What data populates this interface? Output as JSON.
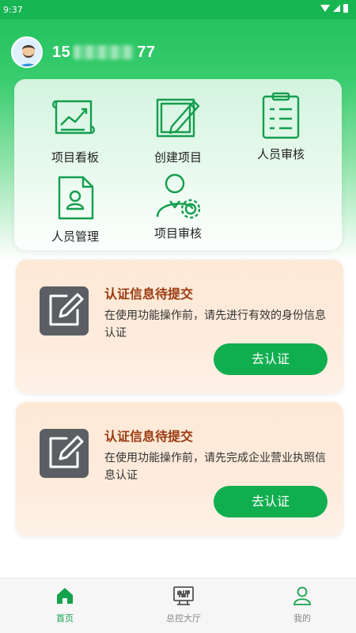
{
  "status_bar": {
    "time": "9:37"
  },
  "user": {
    "phone_prefix": "15",
    "phone_suffix": "77"
  },
  "menu": {
    "items": [
      {
        "label": "项目看板",
        "icon": "dashboard-chart-icon"
      },
      {
        "label": "创建项目",
        "icon": "create-edit-icon"
      },
      {
        "label": "人员审核",
        "icon": "clipboard-review-icon"
      },
      {
        "label": "人员管理",
        "icon": "person-document-icon"
      },
      {
        "label": "项目审核",
        "icon": "user-gear-icon"
      }
    ]
  },
  "notices": [
    {
      "title": "认证信息待提交",
      "desc": "在使用功能操作前，请先进行有效的身份信息认证",
      "button": "去认证"
    },
    {
      "title": "认证信息待提交",
      "desc": "在使用功能操作前，请先完成企业营业执照信息认证",
      "button": "去认证"
    }
  ],
  "tabs": [
    {
      "label": "首页",
      "icon": "home-icon",
      "active": true
    },
    {
      "label": "总控大厅",
      "icon": "control-panel-icon",
      "active": false
    },
    {
      "label": "我的",
      "icon": "profile-icon",
      "active": false
    }
  ],
  "colors": {
    "brand_green": "#11ae50",
    "notice_title": "#9a3a12",
    "notice_bg": "#fde9d6"
  }
}
